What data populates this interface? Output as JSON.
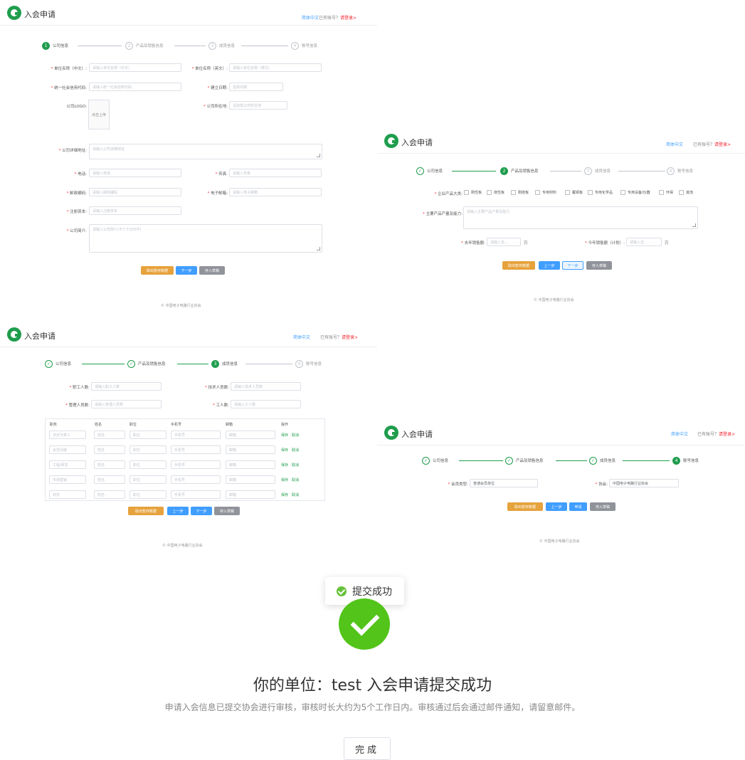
{
  "app_title": "入会申请",
  "lang": "简体中文",
  "has_account": "已有账号？",
  "login": "请登录>",
  "steps": [
    "公司信息",
    "产品及销售信息",
    "成员信息",
    "账号信息"
  ],
  "step_numbers": [
    "1",
    "2",
    "3",
    "4"
  ],
  "done_mark": "✓",
  "footer": "© 中国电子电路行业协会",
  "buttons": {
    "fetch": "取出暂存数据",
    "prev": "上一步",
    "next": "下一步",
    "save": "存入草稿",
    "apply": "申请"
  },
  "panel1": {
    "name_cn_label": "单位名称（中文）:",
    "name_cn_ph": "请输入单位名称（中文）",
    "name_en_label": "单位名称（英文）:",
    "name_en_ph": "请输入单位名称（英文）",
    "credit_label": "统一社会信用代码:",
    "credit_ph": "请输入统一社会信用代码",
    "founded_label": "建立日期:",
    "founded_ph": "选择日期",
    "logo_label": "公司LOGO:",
    "upload_label": "点击上传",
    "location_label": "公司所在地:",
    "location_ph": "请选择公司所在地",
    "address_label": "公司详细地址:",
    "address_ph": "请输入公司详细地址",
    "phone_label": "电话:",
    "phone_ph": "请输入电话",
    "fax_label": "传真:",
    "fax_ph": "请输入传真",
    "zip_label": "邮政编码:",
    "zip_ph": "请输入邮政编码",
    "email_label": "电子邮箱:",
    "email_ph": "请输入电子邮箱",
    "capital_label": "注册资本:",
    "capital_ph": "请输入注册资本",
    "intro_label": "公司简介:",
    "intro_ph": "请输入公司简介(不少于200字)"
  },
  "panel2": {
    "category_label": "企业产品大类:",
    "categories": [
      "刚性板",
      "挠性板",
      "刚挠板",
      "专用材料",
      "覆铜板",
      "专用化学品",
      "专用设备/仪器",
      "环保",
      "其他"
    ],
    "main_label": "主要产品产量及能力:",
    "main_ph": "请输入主要产品产量及能力",
    "last_label": "去年销售额:",
    "last_ph": "请输入去...",
    "unit": "万",
    "this_label": "今年销售额（计划）:",
    "this_ph": "请输入去..."
  },
  "panel3": {
    "staff_label": "职工人数:",
    "staff_ph": "请输入职工人数",
    "tech_label": "技术人员数:",
    "tech_ph": "请输入技术人员数",
    "mgmt_label": "管理人员数:",
    "mgmt_ph": "请输入管理人员数",
    "worker_label": "工人数:",
    "worker_ph": "请输入工人数",
    "headers": [
      "职务",
      "姓名",
      "职位",
      "手机号",
      "邮箱",
      "操作"
    ],
    "rows": [
      "法定代表人",
      "会员对接",
      "工程/研发",
      "市场营销",
      "财务"
    ],
    "cell_ph": [
      "姓名",
      "职位",
      "手机号",
      "邮箱"
    ],
    "op_save": "保存",
    "op_cancel": "取消"
  },
  "panel4": {
    "type_label": "会员类型:",
    "type_value": "普通会员单位",
    "assoc_label": "协会:",
    "assoc_value": "中国电子电路行业协会"
  },
  "result": {
    "toast": "提交成功",
    "title": "你的单位：test 入会申请提交成功",
    "desc": "申请入会信息已提交协会进行审核，审核时长大约为5个工作日内。审核通过后会通过邮件通知，请留意邮件。",
    "done": "完成"
  }
}
